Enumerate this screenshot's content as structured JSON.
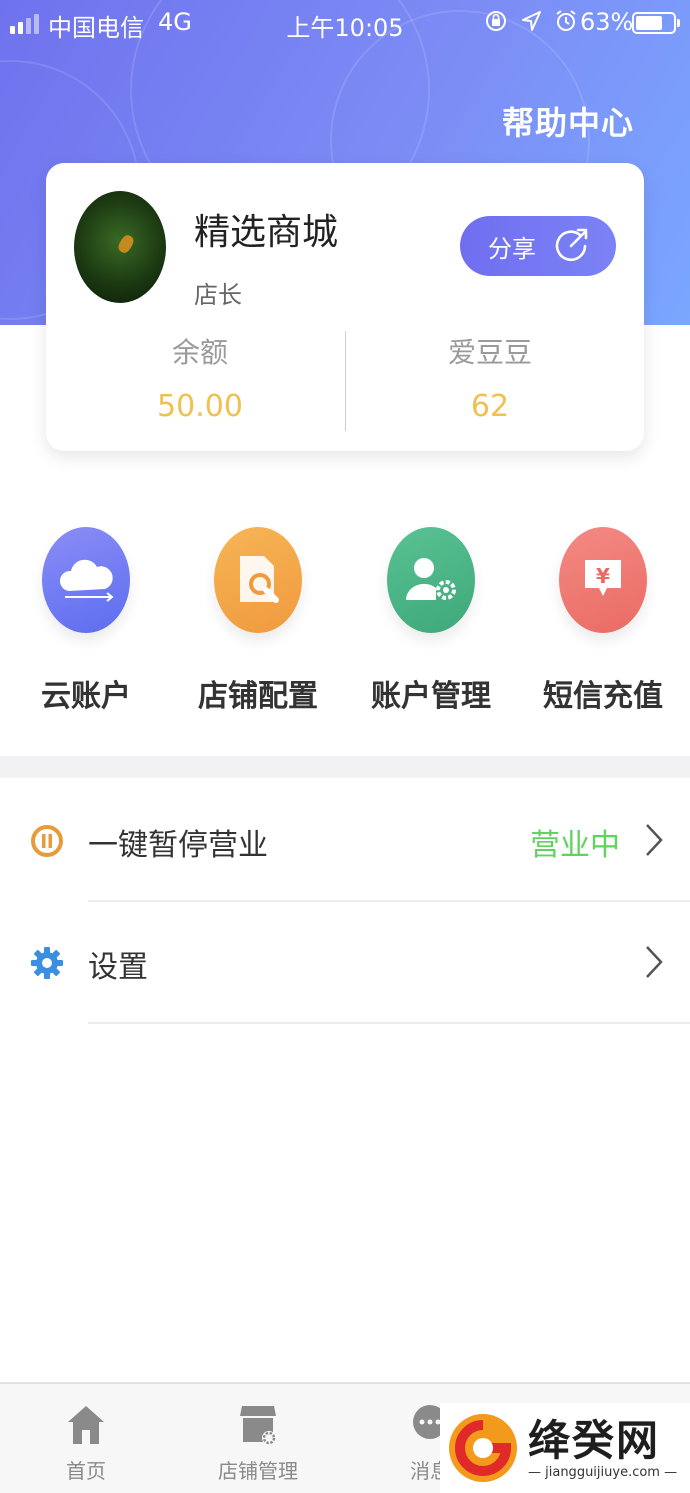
{
  "status_bar": {
    "carrier": "中国电信",
    "network": "4G",
    "time": "上午10:05",
    "battery_percent": "63%"
  },
  "header": {
    "help_link": "帮助中心",
    "gradient_colors": [
      "#6f72ee",
      "#7aa7ff"
    ]
  },
  "profile": {
    "shop_name": "精选商城",
    "role": "店长",
    "share_label": "分享",
    "balance_label": "余额",
    "balance_value": "50.00",
    "beans_label": "爱豆豆",
    "beans_value": "62"
  },
  "actions": [
    {
      "label": "云账户",
      "icon": "cloud-icon",
      "color": "#6f7cf2"
    },
    {
      "label": "店铺配置",
      "icon": "store-config-icon",
      "color": "#f3a648"
    },
    {
      "label": "账户管理",
      "icon": "user-settings-icon",
      "color": "#4cb58a"
    },
    {
      "label": "短信充值",
      "icon": "sms-recharge-icon",
      "color": "#ef7a73"
    }
  ],
  "settings_list": [
    {
      "label": "一键暂停营业",
      "status": "营业中",
      "icon": "pause-icon"
    },
    {
      "label": "设置",
      "status": "",
      "icon": "gear-icon"
    }
  ],
  "tabbar": [
    {
      "label": "首页",
      "icon": "home-icon"
    },
    {
      "label": "店铺管理",
      "icon": "store-manage-icon"
    },
    {
      "label": "消息",
      "icon": "message-icon"
    }
  ],
  "watermark": {
    "title": "绛癸网",
    "url": "— jiangguijiuye.com —"
  }
}
